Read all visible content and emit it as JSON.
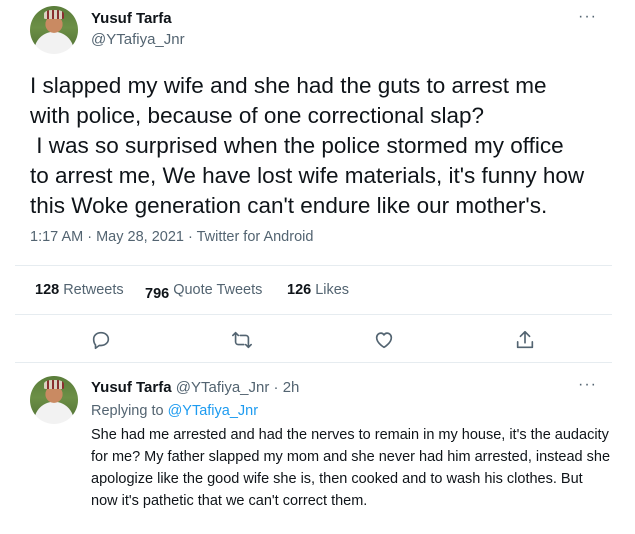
{
  "tweet": {
    "author_name": "Yusuf Tarfa",
    "author_handle": "@YTafiya_Jnr",
    "more_label": "···",
    "text": "I slapped my wife and she had the guts to arrest me\nwith police, because of one correctional slap?\n I was so surprised when the police stormed my office\nto arrest me, We have lost wife materials, it's funny how\nthis Woke generation can't endure like our mother's.",
    "meta": "1:17 AM · May 28, 2021 · Twitter for Android",
    "stats": {
      "retweets_count": "128",
      "retweets_label": "Retweets",
      "quote_count": "796",
      "quote_label": "Quote Tweets",
      "likes_count": "126",
      "likes_label": "Likes"
    },
    "actions": [
      "reply-icon",
      "retweet-icon",
      "like-icon",
      "share-icon"
    ],
    "icon_color": "#536471"
  },
  "reply": {
    "author_name": "Yusuf Tarfa",
    "author_handle": "@YTafiya_Jnr",
    "separator": "·",
    "time": "2h",
    "more_label": "···",
    "replying_prefix": "Replying to",
    "replying_to": "@YTafiya_Jnr",
    "text": "She had me arrested and had the nerves to remain in my house, it's the audacity for me? My father slapped my mom and she never had him arrested, instead she apologize like the good wife she is, then cooked and to wash his clothes. But now it's pathetic that we can't correct them."
  },
  "colors": {
    "link": "#1d9bf0",
    "text_primary": "#0f1419",
    "text_secondary": "#536471",
    "divider": "#e6ecf0"
  }
}
